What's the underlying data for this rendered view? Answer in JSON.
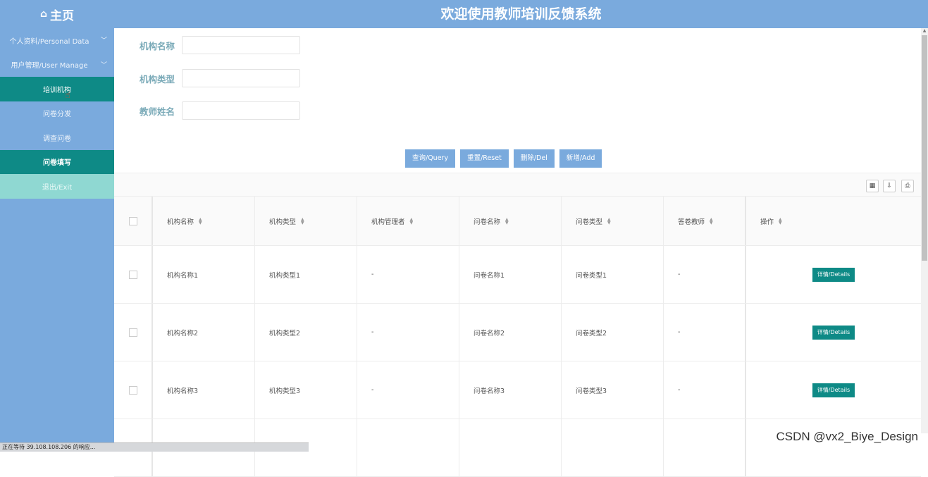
{
  "header": {
    "home_label": "主页",
    "home_icon": "home-icon",
    "title": "欢迎使用教师培训反馈系统"
  },
  "sidebar": {
    "items": [
      {
        "label": "个人资料/Personal Data",
        "expandable": true
      },
      {
        "label": "用户管理/User Manage",
        "expandable": true
      },
      {
        "label": "培训机构"
      },
      {
        "label": "问卷分发"
      },
      {
        "label": "调查问卷"
      },
      {
        "label": "问卷填写"
      },
      {
        "label": "退出/Exit"
      }
    ]
  },
  "search": {
    "fields": [
      {
        "label": "机构名称",
        "value": ""
      },
      {
        "label": "机构类型",
        "value": ""
      },
      {
        "label": "教师姓名",
        "value": ""
      }
    ],
    "buttons": {
      "query": "查询/Query",
      "reset": "重置/Reset",
      "delete": "删除/Del",
      "add": "新增/Add"
    }
  },
  "table": {
    "columns": [
      "机构名称",
      "机构类型",
      "机构管理者",
      "问卷名称",
      "问卷类型",
      "答卷教师",
      "操作"
    ],
    "rows": [
      {
        "c1": "机构名称1",
        "c2": "机构类型1",
        "c3": "-",
        "c4": "问卷名称1",
        "c5": "问卷类型1",
        "c6": "-",
        "action": "详情/Details"
      },
      {
        "c1": "机构名称2",
        "c2": "机构类型2",
        "c3": "-",
        "c4": "问卷名称2",
        "c5": "问卷类型2",
        "c6": "-",
        "action": "详情/Details"
      },
      {
        "c1": "机构名称3",
        "c2": "机构类型3",
        "c3": "-",
        "c4": "问卷名称3",
        "c5": "问卷类型3",
        "c6": "-",
        "action": "详情/Details"
      }
    ]
  },
  "statusbar": {
    "text": "正在等待 39.108.108.206 的响应..."
  },
  "watermark": "CSDN @vx2_Biye_Design",
  "colors": {
    "header": "#7aaadd",
    "active": "#0e8a86",
    "exit": "#8fd8d2",
    "label": "#7aaab8"
  }
}
